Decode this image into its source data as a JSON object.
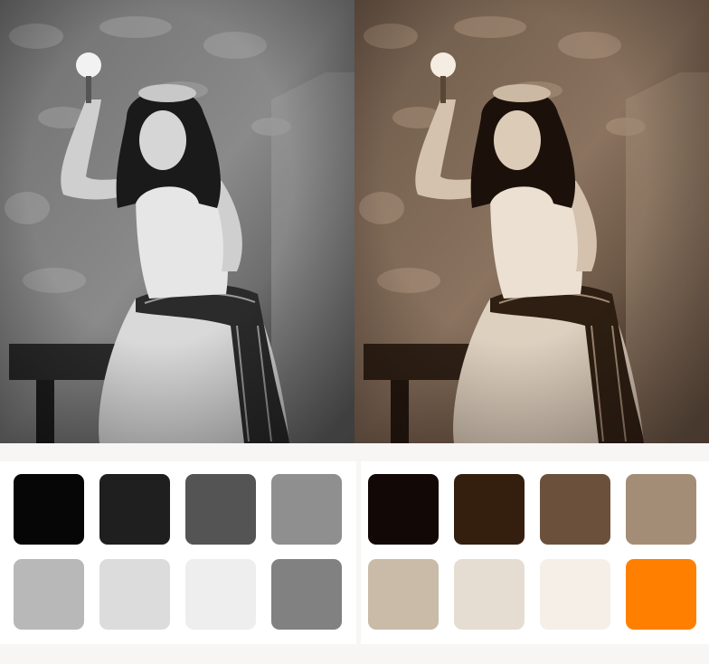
{
  "grayscale_palette": {
    "swatches": [
      {
        "color": "#060606"
      },
      {
        "color": "#1f1f1f"
      },
      {
        "color": "#545454"
      },
      {
        "color": "#8f8f8f"
      },
      {
        "color": "#b8b8b8"
      },
      {
        "color": "#dcdcdc"
      },
      {
        "color": "#eeeeee"
      },
      {
        "color": "#818181"
      }
    ]
  },
  "sepia_palette": {
    "swatches": [
      {
        "color": "#120806"
      },
      {
        "color": "#341f0f"
      },
      {
        "color": "#6b513c"
      },
      {
        "color": "#a48d77"
      },
      {
        "color": "#c9bba8"
      },
      {
        "color": "#e6ddd2"
      },
      {
        "color": "#f6efe7"
      },
      {
        "color": "#ff7f00"
      }
    ]
  }
}
